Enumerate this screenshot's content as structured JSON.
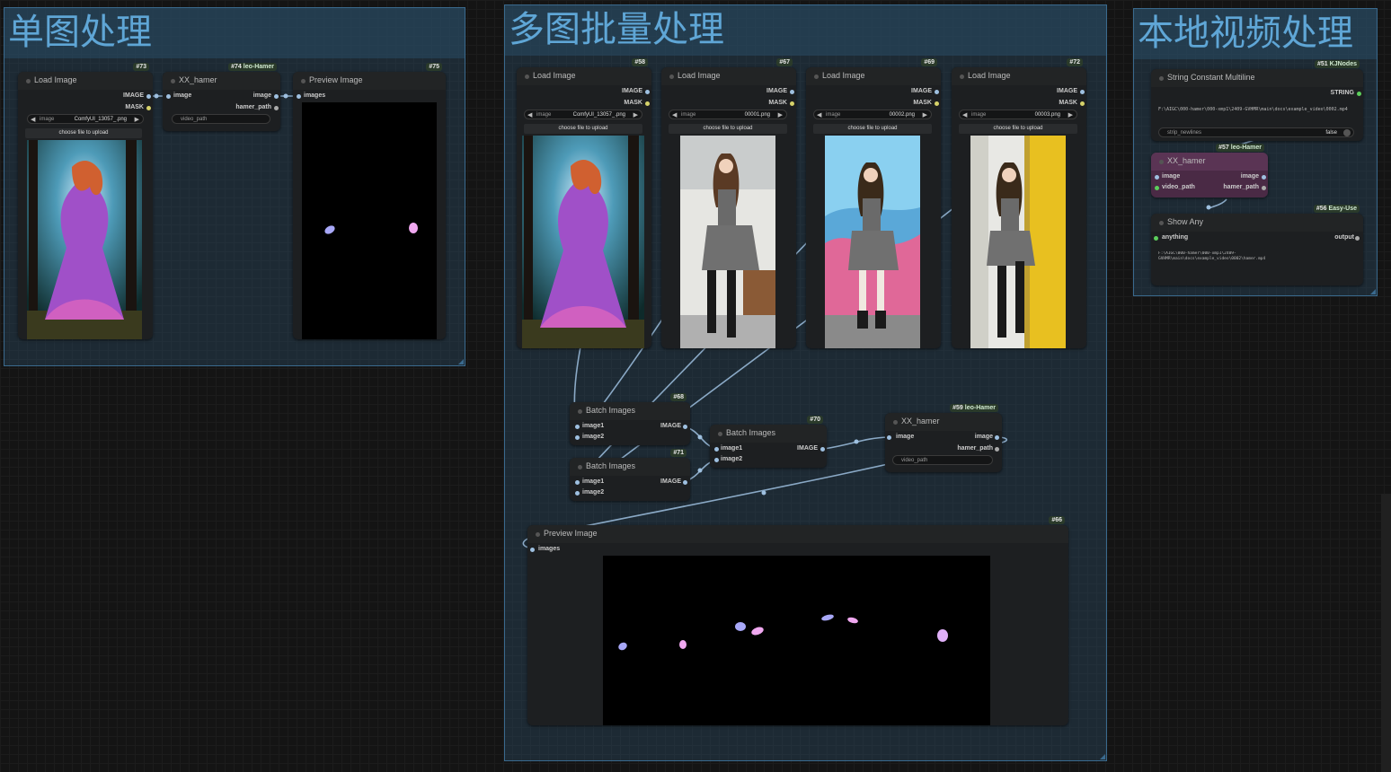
{
  "groups": {
    "single": {
      "title": "单图处理"
    },
    "multi": {
      "title": "多图批量处理"
    },
    "video": {
      "title": "本地视频处理"
    }
  },
  "slots": {
    "image_out": "IMAGE",
    "mask_out": "MASK",
    "image_in": "image",
    "image_out_lc": "image",
    "hamer_path": "hamer_path",
    "images": "images",
    "image1": "image1",
    "image2": "image2",
    "video_path": "video_path",
    "string_out": "STRING",
    "anything": "anything",
    "output": "output"
  },
  "common": {
    "choose_file": "choose file to upload",
    "image_widget": "image",
    "video_path_placeholder": "video_path"
  },
  "nodes": {
    "n73": {
      "id": "#73",
      "title": "Load Image",
      "file": "ComfyUI_13057_.png"
    },
    "n74": {
      "id": "#74",
      "source": "leo-Hamer",
      "title": "XX_hamer"
    },
    "n75": {
      "id": "#75",
      "title": "Preview Image"
    },
    "n58": {
      "id": "#58",
      "title": "Load Image",
      "file": "ComfyUI_13057_.png"
    },
    "n67": {
      "id": "#67",
      "title": "Load Image",
      "file": "00001.png"
    },
    "n69": {
      "id": "#69",
      "title": "Load Image",
      "file": "00002.png"
    },
    "n72": {
      "id": "#72",
      "title": "Load Image",
      "file": "00003.png"
    },
    "n68": {
      "id": "#68",
      "title": "Batch Images"
    },
    "n71": {
      "id": "#71",
      "title": "Batch Images"
    },
    "n70": {
      "id": "#70",
      "title": "Batch Images"
    },
    "n59": {
      "id": "#59",
      "source": "leo-Hamer",
      "title": "XX_hamer"
    },
    "n66": {
      "id": "#66",
      "title": "Preview Image"
    },
    "n51": {
      "id": "#51",
      "source": "KJNodes",
      "title": "String Constant Multiline",
      "text": "F:\\AIGC\\000-hamer\\000-xmp1\\2409-GVHMR\\main\\docs\\example_video\\0002.mp4",
      "strip_label": "strip_newlines",
      "strip_value": "false"
    },
    "n57": {
      "id": "#57",
      "source": "leo-Hamer",
      "title": "XX_hamer"
    },
    "n56": {
      "id": "#56",
      "source": "Easy-Use",
      "title": "Show Any",
      "text_line1": "F:\\AIGC\\000-hamer\\000-xmp1\\2409-",
      "text_line2": "GVHMR\\main\\docs\\example_video\\0002\\hamer.mp4"
    }
  },
  "colors": {
    "background": "#141414",
    "group_fill": "#2e4e68",
    "group_title": "#5fa6d6",
    "node_body": "#1d1f21",
    "wire": "#9ec0e0",
    "hamer_node": "#4a2a45"
  }
}
